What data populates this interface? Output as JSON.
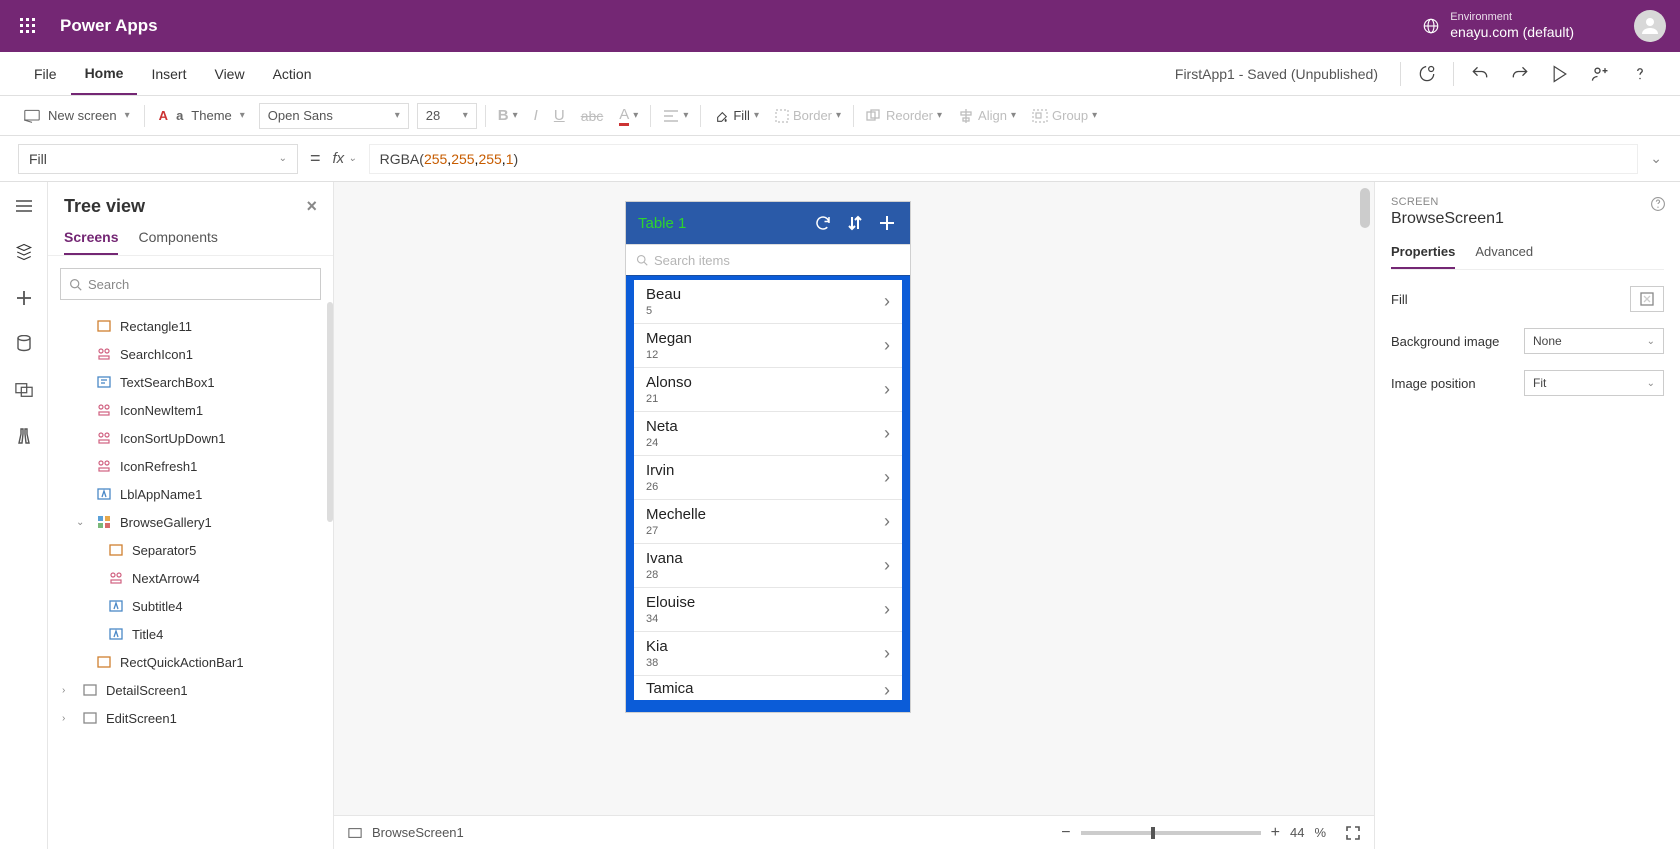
{
  "header": {
    "app_title": "Power Apps",
    "env_label": "Environment",
    "env_name": "enayu.com (default)"
  },
  "menu": {
    "items": [
      "File",
      "Home",
      "Insert",
      "View",
      "Action"
    ],
    "active_index": 1,
    "project_status": "FirstApp1 - Saved (Unpublished)"
  },
  "ribbon": {
    "new_screen": "New screen",
    "theme": "Theme",
    "font": "Open Sans",
    "font_size": "28",
    "fill_label": "Fill",
    "border_label": "Border",
    "reorder": "Reorder",
    "align": "Align",
    "group": "Group"
  },
  "formula": {
    "property": "Fill",
    "fx": "fx",
    "fn": "RGBA",
    "args": [
      "255",
      "255",
      "255",
      "1"
    ]
  },
  "tree": {
    "title": "Tree view",
    "tabs": {
      "screens": "Screens",
      "components": "Components"
    },
    "search_placeholder": "Search",
    "items": [
      {
        "label": "Rectangle11",
        "indent": 0,
        "icon": "rect"
      },
      {
        "label": "SearchIcon1",
        "indent": 0,
        "icon": "group"
      },
      {
        "label": "TextSearchBox1",
        "indent": 0,
        "icon": "textbox"
      },
      {
        "label": "IconNewItem1",
        "indent": 0,
        "icon": "group"
      },
      {
        "label": "IconSortUpDown1",
        "indent": 0,
        "icon": "group"
      },
      {
        "label": "IconRefresh1",
        "indent": 0,
        "icon": "group"
      },
      {
        "label": "LblAppName1",
        "indent": 0,
        "icon": "label"
      },
      {
        "label": "BrowseGallery1",
        "indent": 0,
        "icon": "gallery",
        "expand": "open"
      },
      {
        "label": "Separator5",
        "indent": 1,
        "icon": "rect"
      },
      {
        "label": "NextArrow4",
        "indent": 1,
        "icon": "group"
      },
      {
        "label": "Subtitle4",
        "indent": 1,
        "icon": "label"
      },
      {
        "label": "Title4",
        "indent": 1,
        "icon": "label"
      },
      {
        "label": "RectQuickActionBar1",
        "indent": 0,
        "icon": "rect"
      },
      {
        "label": "DetailScreen1",
        "indent": -1,
        "icon": "screen",
        "expand": "closed"
      },
      {
        "label": "EditScreen1",
        "indent": -1,
        "icon": "screen",
        "expand": "closed"
      }
    ]
  },
  "phone": {
    "title": "Table 1",
    "search_placeholder": "Search items",
    "rows": [
      {
        "name": "Beau",
        "sub": "5"
      },
      {
        "name": "Megan",
        "sub": "12"
      },
      {
        "name": "Alonso",
        "sub": "21"
      },
      {
        "name": "Neta",
        "sub": "24"
      },
      {
        "name": "Irvin",
        "sub": "26"
      },
      {
        "name": "Mechelle",
        "sub": "27"
      },
      {
        "name": "Ivana",
        "sub": "28"
      },
      {
        "name": "Elouise",
        "sub": "34"
      },
      {
        "name": "Kia",
        "sub": "38"
      },
      {
        "name": "Tamica",
        "sub": ""
      }
    ]
  },
  "canvas_footer": {
    "breadcrumb": "BrowseScreen1",
    "zoom_value": "44",
    "zoom_unit": "%"
  },
  "props": {
    "section_label": "SCREEN",
    "name": "BrowseScreen1",
    "tabs": {
      "properties": "Properties",
      "advanced": "Advanced"
    },
    "fill_label": "Fill",
    "bg_image_label": "Background image",
    "bg_image_value": "None",
    "img_pos_label": "Image position",
    "img_pos_value": "Fit"
  }
}
